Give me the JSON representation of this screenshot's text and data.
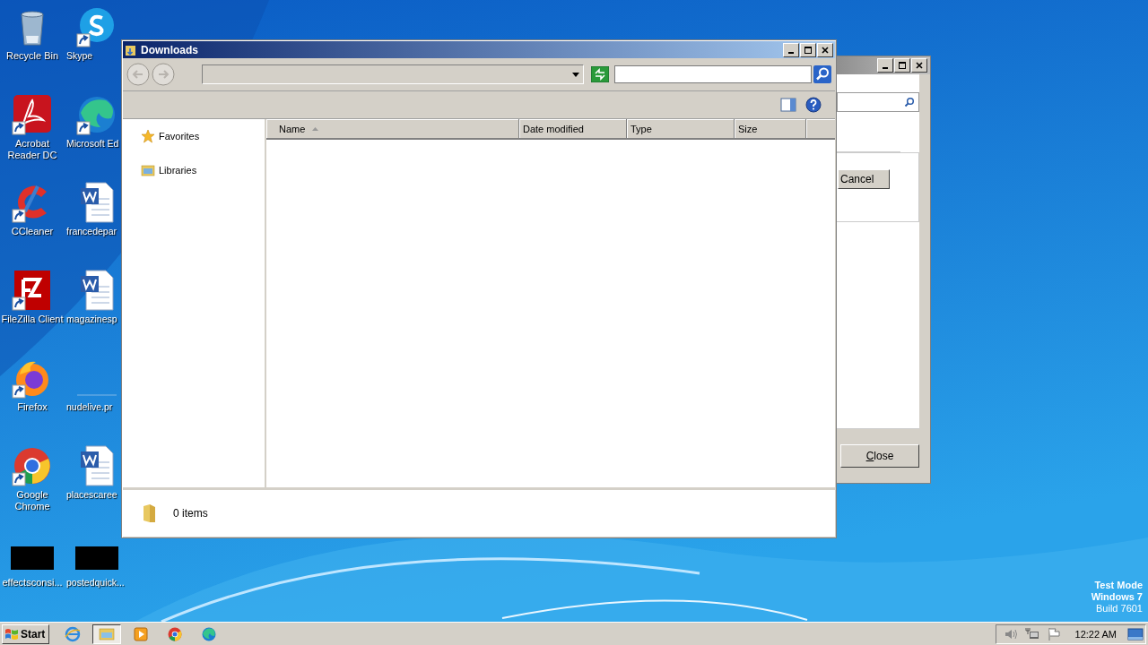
{
  "desktop": {
    "icons": [
      {
        "label": "Recycle Bin",
        "kind": "bin",
        "shortcut": false
      },
      {
        "label": "Skype",
        "kind": "chat-app",
        "shortcut": true
      },
      {
        "label": "Acrobat Reader DC",
        "kind": "pdf-app",
        "shortcut": true
      },
      {
        "label": "Microsoft Ed",
        "kind": "wave-app",
        "shortcut": true
      },
      {
        "label": "CCleaner",
        "kind": "cleaner-app",
        "shortcut": true
      },
      {
        "label": "francedepar",
        "kind": "document",
        "shortcut": false
      },
      {
        "label": "FileZilla Client",
        "kind": "ftp-app",
        "shortcut": true
      },
      {
        "label": "magazinesp",
        "kind": "document",
        "shortcut": false
      },
      {
        "label": "Firefox",
        "kind": "fox-app",
        "shortcut": true
      },
      {
        "label": "nudelive.pr",
        "kind": "blank",
        "shortcut": false
      },
      {
        "label": "Google Chrome",
        "kind": "browser-app",
        "shortcut": true
      },
      {
        "label": "placescaree",
        "kind": "document",
        "shortcut": false
      },
      {
        "label": "effectsconsi...",
        "kind": "thumbnail",
        "shortcut": false
      },
      {
        "label": "postedquick...",
        "kind": "thumbnail",
        "shortcut": false
      }
    ],
    "notice": [
      {
        "text": "Test Mode",
        "bold": true
      },
      {
        "text": "Windows 7",
        "bold": true
      },
      {
        "text": "Build 7601",
        "bold": false
      }
    ]
  },
  "back_window": {
    "buttons": [
      "Cancel",
      "Close"
    ]
  },
  "window": {
    "title": "Downloads",
    "navigation": [
      {
        "label": "Favorites",
        "kind": "star"
      },
      {
        "label": "Libraries",
        "kind": "library"
      }
    ],
    "columns": [
      {
        "label": "Name",
        "sorted": true
      },
      {
        "label": "Date modified",
        "sorted": false
      },
      {
        "label": "Type",
        "sorted": false
      },
      {
        "label": "Size",
        "sorted": false
      }
    ],
    "status": "0 items"
  },
  "taskbar": {
    "start": "Start",
    "items": [
      {
        "kind": "globe",
        "selected": false
      },
      {
        "kind": "folder",
        "selected": true
      },
      {
        "kind": "player",
        "selected": false
      },
      {
        "kind": "chrome",
        "selected": false
      },
      {
        "kind": "wave",
        "selected": false
      }
    ],
    "clock": "12:22 AM"
  }
}
